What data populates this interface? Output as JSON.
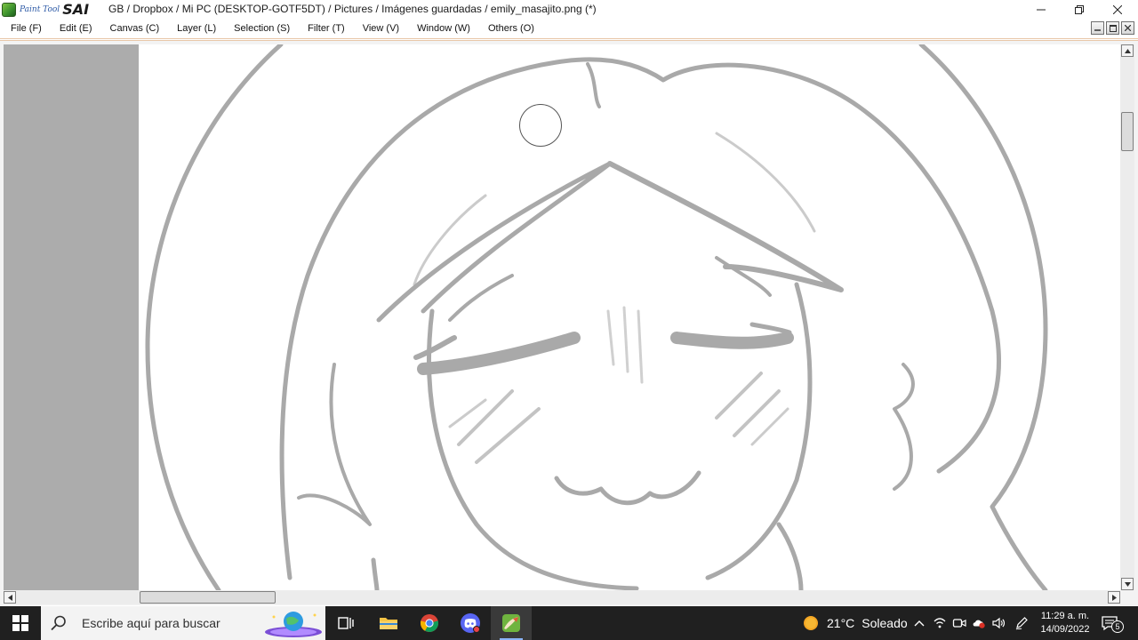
{
  "app": {
    "logo_small": "Paint Tool",
    "logo_big": "SAI",
    "window_title": "GB / Dropbox / Mi PC (DESKTOP-GOTF5DT) / Pictures / Imágenes guardadas / emily_masajito.png (*)"
  },
  "window_controls": {
    "minimize_icon": "minimize-icon",
    "maximize_icon": "restore-icon",
    "close_icon": "close-icon"
  },
  "menu": {
    "items": [
      {
        "label": "File (F)"
      },
      {
        "label": "Edit (E)"
      },
      {
        "label": "Canvas (C)"
      },
      {
        "label": "Layer (L)"
      },
      {
        "label": "Selection (S)"
      },
      {
        "label": "Filter (T)"
      },
      {
        "label": "View (V)"
      },
      {
        "label": "Window (W)"
      },
      {
        "label": "Others (O)"
      }
    ]
  },
  "colors": {
    "canvas_bg": "#ffffff",
    "outside_canvas": "#acacac",
    "sketch_stroke": "#a9a9a9",
    "taskbar_bg": "#202020",
    "accent": "#e8c7a8"
  },
  "taskbar": {
    "search_placeholder": "Escribe aquí para buscar",
    "apps": [
      {
        "icon": "task-view-icon"
      },
      {
        "icon": "file-explorer-icon"
      },
      {
        "icon": "chrome-icon"
      },
      {
        "icon": "discord-icon"
      },
      {
        "icon": "paint-tool-sai-icon"
      }
    ],
    "weather": {
      "temp": "21°C",
      "condition": "Soleado"
    },
    "clock": {
      "time": "11:29 a. m.",
      "date": "14/09/2022"
    },
    "notifications": "5"
  }
}
